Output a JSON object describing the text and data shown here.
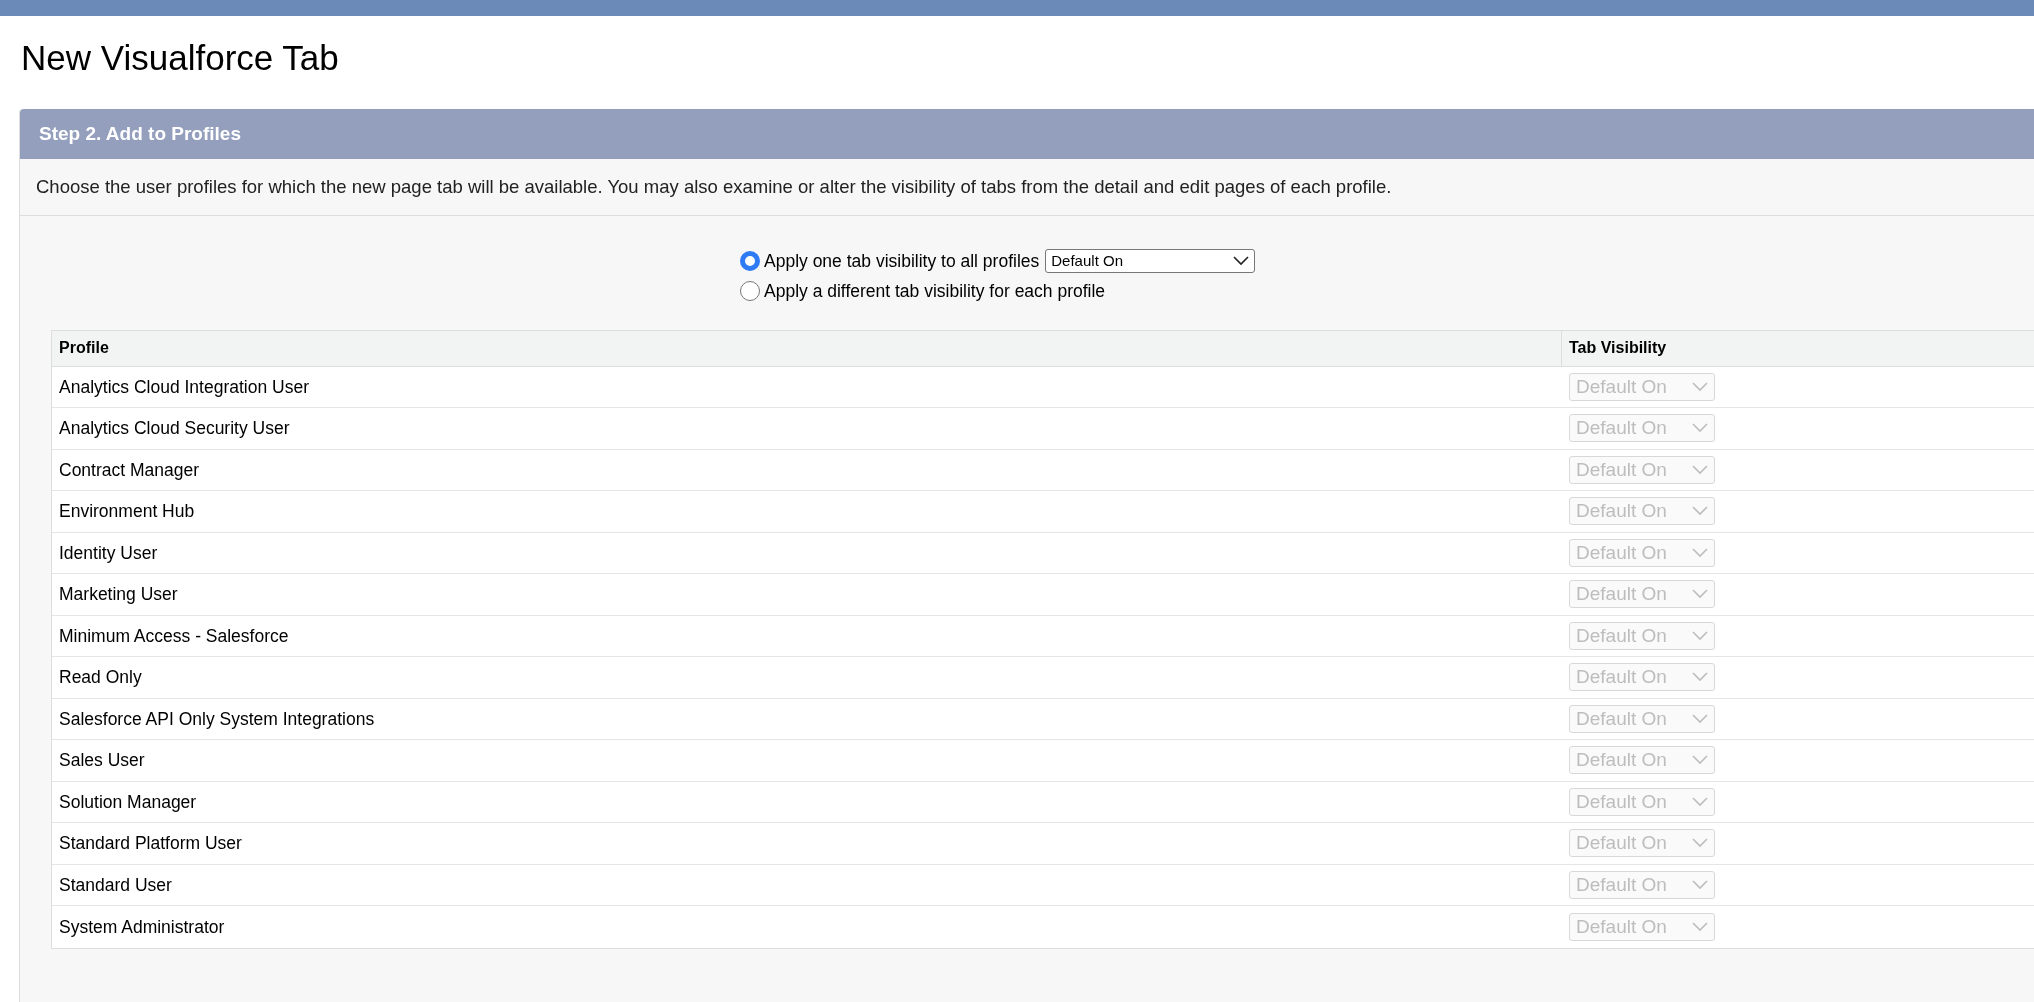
{
  "page_title": "New Visualforce Tab",
  "step": {
    "title": "Step 2. Add to Profiles",
    "description": "Choose the user profiles for which the new page tab will be available. You may also examine or alter the visibility of tabs from the detail and edit pages of each profile."
  },
  "visibility_options": [
    {
      "label": "Apply one tab visibility to all profiles",
      "selected": true,
      "dropdown": {
        "value": "Default On"
      }
    },
    {
      "label": "Apply a different tab visibility for each profile",
      "selected": false
    }
  ],
  "table": {
    "columns": [
      "Profile",
      "Tab Visibility"
    ],
    "rows": [
      {
        "profile": "Analytics Cloud Integration User",
        "visibility": "Default On",
        "disabled": true
      },
      {
        "profile": "Analytics Cloud Security User",
        "visibility": "Default On",
        "disabled": true
      },
      {
        "profile": "Contract Manager",
        "visibility": "Default On",
        "disabled": true
      },
      {
        "profile": "Environment Hub",
        "visibility": "Default On",
        "disabled": true
      },
      {
        "profile": "Identity User",
        "visibility": "Default On",
        "disabled": true
      },
      {
        "profile": "Marketing User",
        "visibility": "Default On",
        "disabled": true
      },
      {
        "profile": "Minimum Access - Salesforce",
        "visibility": "Default On",
        "disabled": true
      },
      {
        "profile": "Read Only",
        "visibility": "Default On",
        "disabled": true
      },
      {
        "profile": "Salesforce API Only System Integrations",
        "visibility": "Default On",
        "disabled": true
      },
      {
        "profile": "Sales User",
        "visibility": "Default On",
        "disabled": true
      },
      {
        "profile": "Solution Manager",
        "visibility": "Default On",
        "disabled": true
      },
      {
        "profile": "Standard Platform User",
        "visibility": "Default On",
        "disabled": true
      },
      {
        "profile": "Standard User",
        "visibility": "Default On",
        "disabled": true
      },
      {
        "profile": "System Administrator",
        "visibility": "Default On",
        "disabled": true
      }
    ]
  }
}
